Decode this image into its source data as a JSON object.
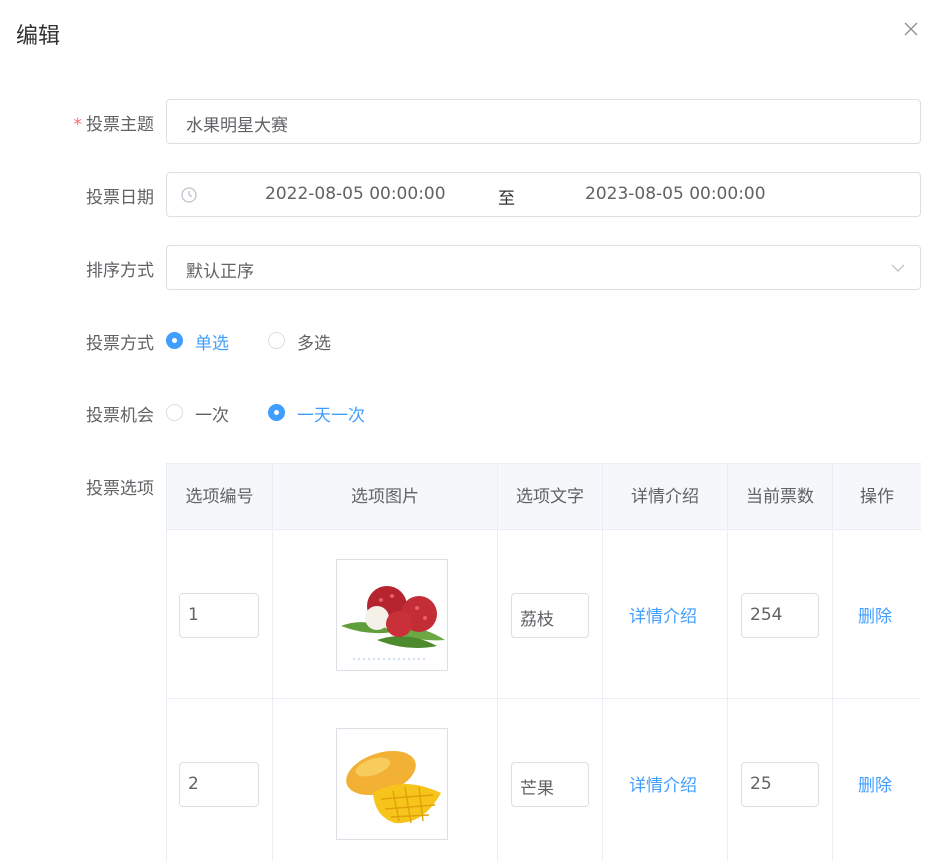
{
  "dialog": {
    "title": "编辑"
  },
  "form": {
    "theme": {
      "label": "投票主题",
      "value": "水果明星大赛"
    },
    "date": {
      "label": "投票日期",
      "start": "2022-08-05 00:00:00",
      "separator": "至",
      "end": "2023-08-05 00:00:00"
    },
    "sort": {
      "label": "排序方式",
      "value": "默认正序"
    },
    "vote_type": {
      "label": "投票方式",
      "options": [
        {
          "label": "单选",
          "checked": true
        },
        {
          "label": "多选",
          "checked": false
        }
      ]
    },
    "vote_chance": {
      "label": "投票机会",
      "options": [
        {
          "label": "一次",
          "checked": false
        },
        {
          "label": "一天一次",
          "checked": true
        }
      ]
    },
    "options_label": "投票选项"
  },
  "table": {
    "headers": [
      "选项编号",
      "选项图片",
      "选项文字",
      "详情介绍",
      "当前票数",
      "操作"
    ],
    "rows": [
      {
        "number": "1",
        "image": "lychee",
        "text": "荔枝",
        "detail": "详情介绍",
        "votes": "254",
        "action": "删除"
      },
      {
        "number": "2",
        "image": "mango",
        "text": "芒果",
        "detail": "详情介绍",
        "votes": "25",
        "action": "删除"
      }
    ]
  },
  "colors": {
    "primary": "#409eff",
    "required": "#f56c6c",
    "border": "#dcdfe6"
  }
}
